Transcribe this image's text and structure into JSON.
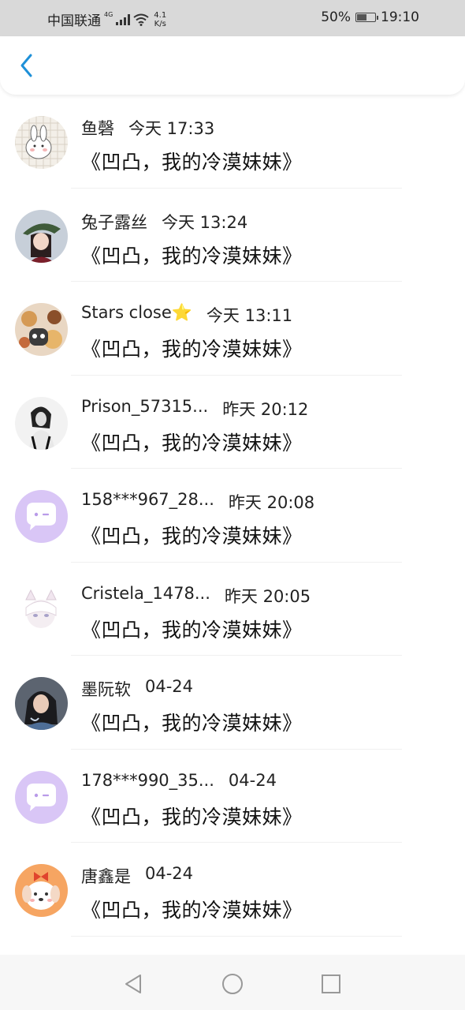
{
  "status_bar": {
    "carrier": "中国联通",
    "net": "4G",
    "speed_top": "4.1",
    "speed_bottom": "K/s",
    "battery": "50%",
    "battery_level": 0.5,
    "time": "19:10"
  },
  "header": {
    "back_icon": "chevron-left-icon",
    "accent": "#1e90d8"
  },
  "comments": [
    {
      "name": "鱼磬",
      "time": "今天 17:33",
      "text": "《凹凸，我的冷漠妹妹》",
      "avatar": "bunny-sketch"
    },
    {
      "name": "兔子露丝",
      "time": "今天 13:24",
      "text": "《凹凸，我的冷漠妹妹》",
      "avatar": "girl-green-hat"
    },
    {
      "name": "Stars close⭐",
      "time": "今天 13:11",
      "text": "《凹凸，我的冷漠妹妹》",
      "avatar": "food-cat"
    },
    {
      "name": "Prison_57315...",
      "time": "昨天 20:12",
      "text": "《凹凸，我的冷漠妹妹》",
      "avatar": "monochrome-girl"
    },
    {
      "name": "158***967_28...",
      "time": "昨天 20:08",
      "text": "《凹凸，我的冷漠妹妹》",
      "avatar": "default-chat"
    },
    {
      "name": "Cristela_1478...",
      "time": "昨天 20:05",
      "text": "《凹凸，我的冷漠妹妹》",
      "avatar": "white-cat-girl"
    },
    {
      "name": "墨阮软",
      "time": "04-24",
      "text": "《凹凸，我的冷漠妹妹》",
      "avatar": "photo-girl"
    },
    {
      "name": "178***990_35...",
      "time": "04-24",
      "text": "《凹凸，我的冷漠妹妹》",
      "avatar": "default-chat"
    },
    {
      "name": "唐鑫是",
      "time": "04-24",
      "text": "《凹凸，我的冷漠妹妹》",
      "avatar": "puppy-bow"
    }
  ],
  "nav": {
    "back": "triangle-back-icon",
    "home": "circle-home-icon",
    "recent": "square-recent-icon"
  }
}
